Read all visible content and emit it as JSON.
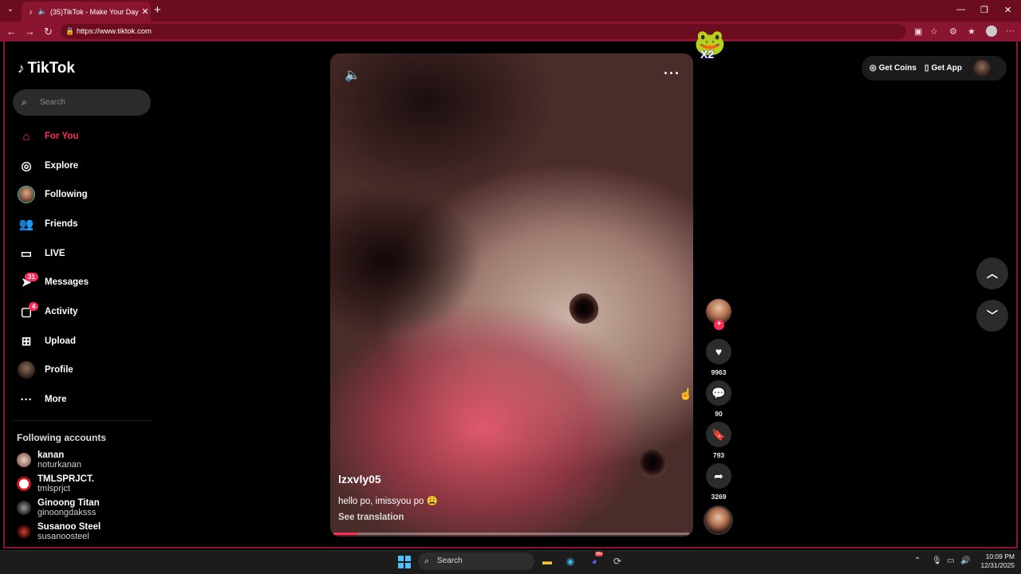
{
  "browser": {
    "tab_title": "(35)TikTok - Make Your Day",
    "url": "https://www.tiktok.com",
    "accent": "#8a1530"
  },
  "sidebar": {
    "logo_text": "TikTok",
    "search_placeholder": "Search",
    "items": [
      {
        "label": "For You",
        "icon": "home-icon"
      },
      {
        "label": "Explore",
        "icon": "compass-icon"
      },
      {
        "label": "Following",
        "icon": "following-avatar"
      },
      {
        "label": "Friends",
        "icon": "friends-icon"
      },
      {
        "label": "LIVE",
        "icon": "live-icon"
      },
      {
        "label": "Messages",
        "icon": "send-icon",
        "badge": "31"
      },
      {
        "label": "Activity",
        "icon": "inbox-icon",
        "badge": "4"
      },
      {
        "label": "Upload",
        "icon": "upload-icon"
      },
      {
        "label": "Profile",
        "icon": "profile-avatar"
      },
      {
        "label": "More",
        "icon": "more-dots-icon"
      }
    ],
    "following_header": "Following accounts",
    "accounts": [
      {
        "name": "kanan",
        "username": "noturkanan"
      },
      {
        "name": "TMLSPRJCT.",
        "username": "tmlsprjct"
      },
      {
        "name": "Ginoong Titan",
        "username": "ginoongdaksss"
      },
      {
        "name": "Susanoo Steel",
        "username": "susanoosteel"
      }
    ]
  },
  "video": {
    "author": "lzxvly05",
    "caption": "hello po, imissyou po 😩",
    "see_translation": "See translation",
    "progress_fraction": 0.07
  },
  "actions": {
    "likes": "9963",
    "comments": "90",
    "saves": "793",
    "shares": "3269"
  },
  "topbar": {
    "get_coins": "Get Coins",
    "get_app": "Get App"
  },
  "taskbar": {
    "search_label": "Search",
    "time": "10:09 PM",
    "date": "12/31/2025",
    "discord_badge": "99+"
  },
  "sticker_text": "X2",
  "brand_color": "#fe2c55"
}
